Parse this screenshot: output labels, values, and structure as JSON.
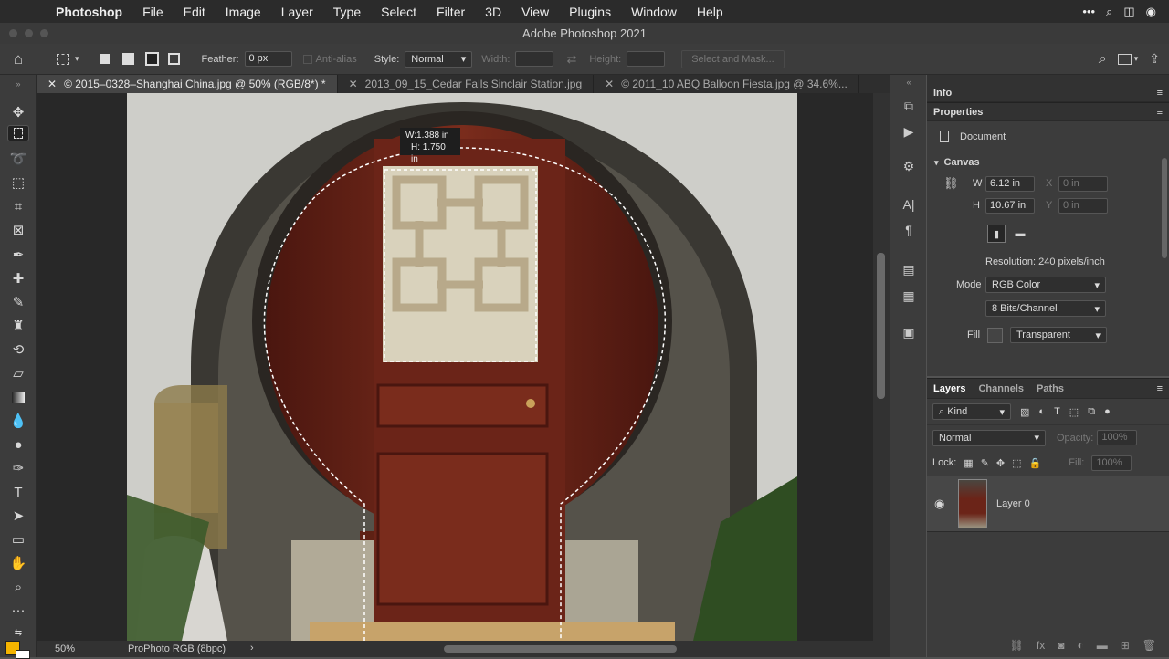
{
  "menubar": {
    "app": "Photoshop",
    "items": [
      "File",
      "Edit",
      "Image",
      "Layer",
      "Type",
      "Select",
      "Filter",
      "3D",
      "View",
      "Plugins",
      "Window",
      "Help"
    ]
  },
  "window": {
    "title": "Adobe Photoshop 2021"
  },
  "options": {
    "feather_label": "Feather:",
    "feather_value": "0 px",
    "antialias_label": "Anti-alias",
    "style_label": "Style:",
    "style_value": "Normal",
    "width_label": "Width:",
    "height_label": "Height:",
    "select_mask": "Select and Mask..."
  },
  "tabs": [
    {
      "label": "© 2015–0328–Shanghai China.jpg @ 50% (RGB/8*) *"
    },
    {
      "label": "2013_09_15_Cedar Falls Sinclair Station.jpg"
    },
    {
      "label": "© 2011_10 ABQ Balloon Fiesta.jpg @ 34.6%..."
    }
  ],
  "selection_tooltip": {
    "w": "W:1.388 in",
    "h": "H: 1.750 in"
  },
  "status": {
    "zoom": "50%",
    "profile": "ProPhoto RGB (8bpc)"
  },
  "info_panel": {
    "title": "Info"
  },
  "properties": {
    "title": "Properties",
    "doc_label": "Document",
    "canvas_label": "Canvas",
    "w_label": "W",
    "w_value": "6.12 in",
    "h_label": "H",
    "h_value": "10.67 in",
    "x_label": "X",
    "x_value": "0 in",
    "y_label": "Y",
    "y_value": "0 in",
    "resolution": "Resolution: 240 pixels/inch",
    "mode_label": "Mode",
    "mode_value": "RGB Color",
    "bits_value": "8 Bits/Channel",
    "fill_label": "Fill",
    "fill_value": "Transparent"
  },
  "layers_panel": {
    "tabs": [
      "Layers",
      "Channels",
      "Paths"
    ],
    "kind": "Kind",
    "blend": "Normal",
    "opacity_label": "Opacity:",
    "opacity_value": "100%",
    "lock_label": "Lock:",
    "fill_label": "Fill:",
    "fill_value": "100%",
    "layer_name": "Layer 0"
  },
  "colors": {
    "accent": "#f5b400",
    "door": "#6b2418"
  }
}
